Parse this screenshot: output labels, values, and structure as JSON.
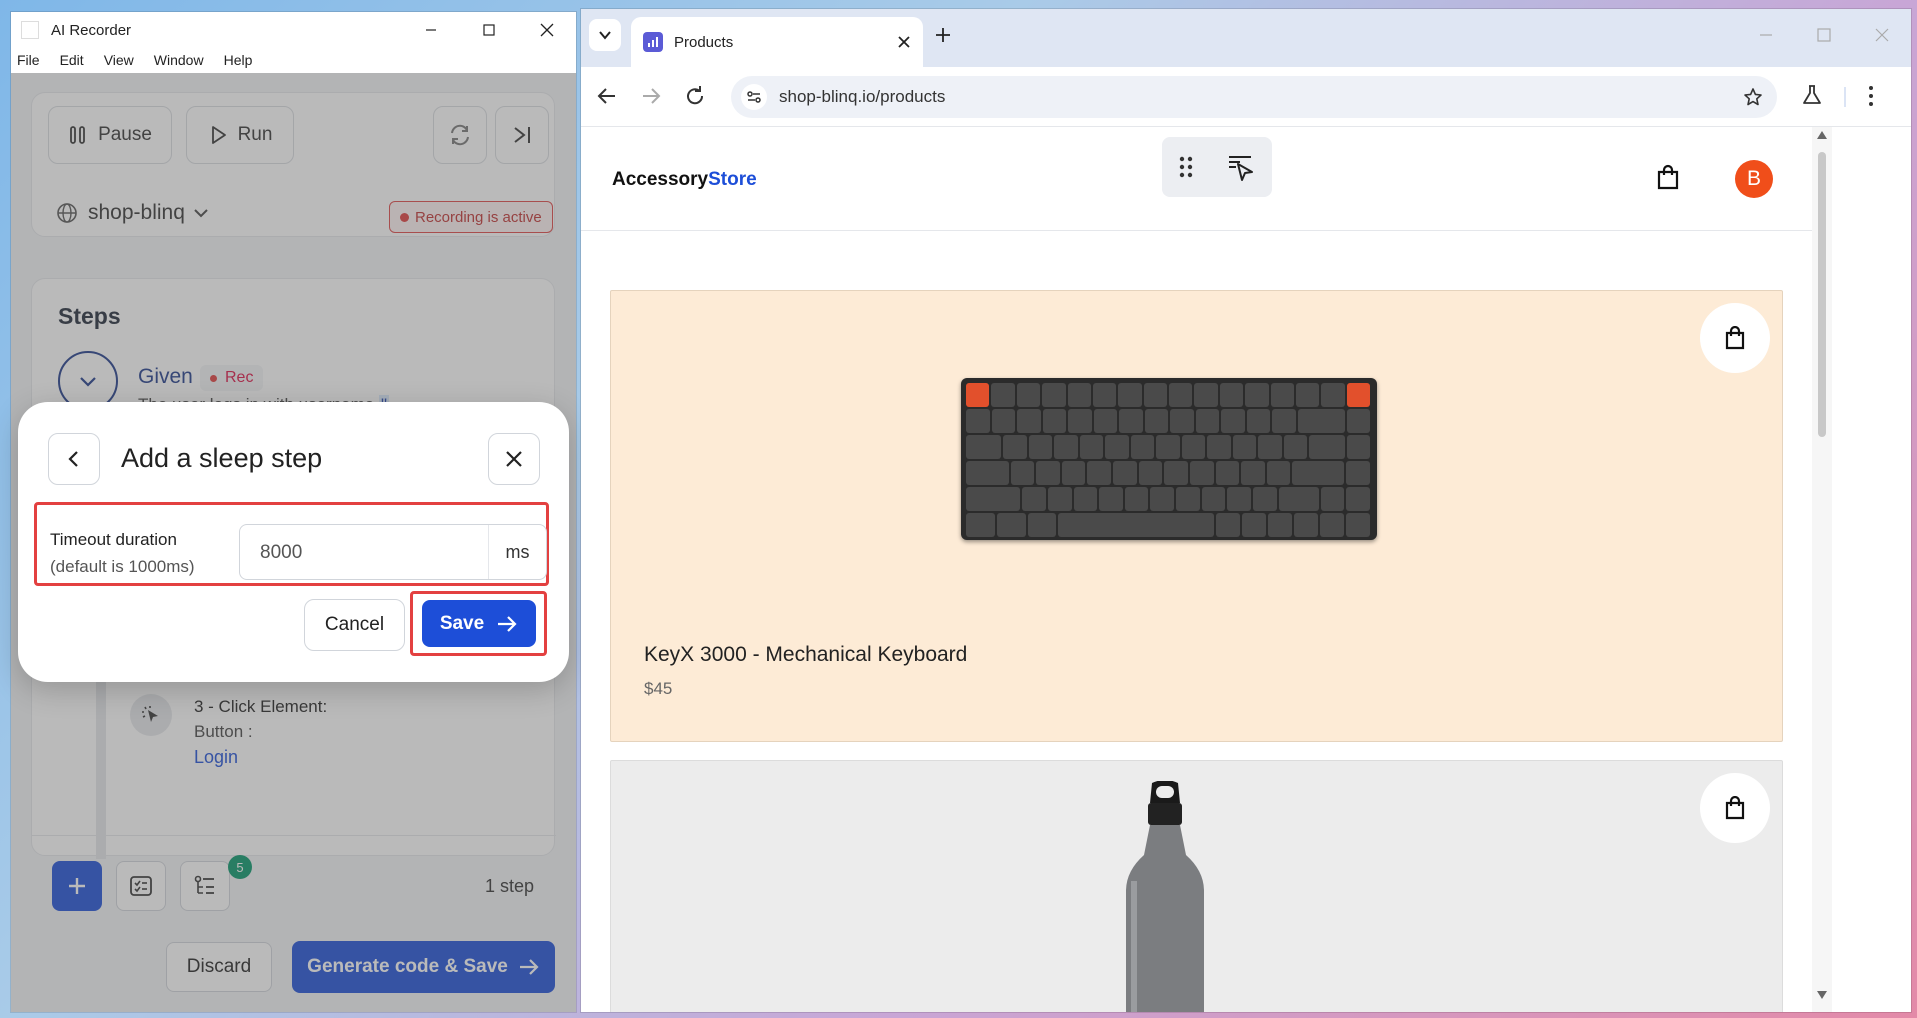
{
  "app": {
    "title": "AI Recorder",
    "menu": [
      "File",
      "Edit",
      "View",
      "Window",
      "Help"
    ],
    "toolbar": {
      "pause_label": "Pause",
      "run_label": "Run",
      "site_name": "shop-blinq",
      "recording_status": "Recording is active"
    },
    "steps": {
      "title": "Steps",
      "given_label": "Given",
      "rec_label": "Rec",
      "given_text": "The user logs in with username",
      "given_param": "\"",
      "step3_title": "3 - Click Element:",
      "step3_type": "Button :",
      "step3_target": "Login",
      "badge_count": "5",
      "step_count": "1 step"
    },
    "footer": {
      "discard_label": "Discard",
      "generate_label": "Generate code & Save"
    }
  },
  "modal": {
    "title": "Add a sleep step",
    "field_label": "Timeout duration",
    "field_hint": "(default is 1000ms)",
    "value": "8000",
    "unit": "ms",
    "cancel_label": "Cancel",
    "save_label": "Save"
  },
  "browser": {
    "tab_title": "Products",
    "url": "shop-blinq.io/products",
    "page": {
      "brand_prefix": "Accessory",
      "brand_suffix": "Store",
      "avatar_initial": "B",
      "products": [
        {
          "name": "KeyX 3000 - Mechanical Keyboard",
          "price": "$45"
        }
      ]
    }
  },
  "colors": {
    "accent": "#1d4ed8",
    "highlight": "#e34040",
    "avatar": "#f04e1a",
    "card_peach": "#fdebd6"
  }
}
